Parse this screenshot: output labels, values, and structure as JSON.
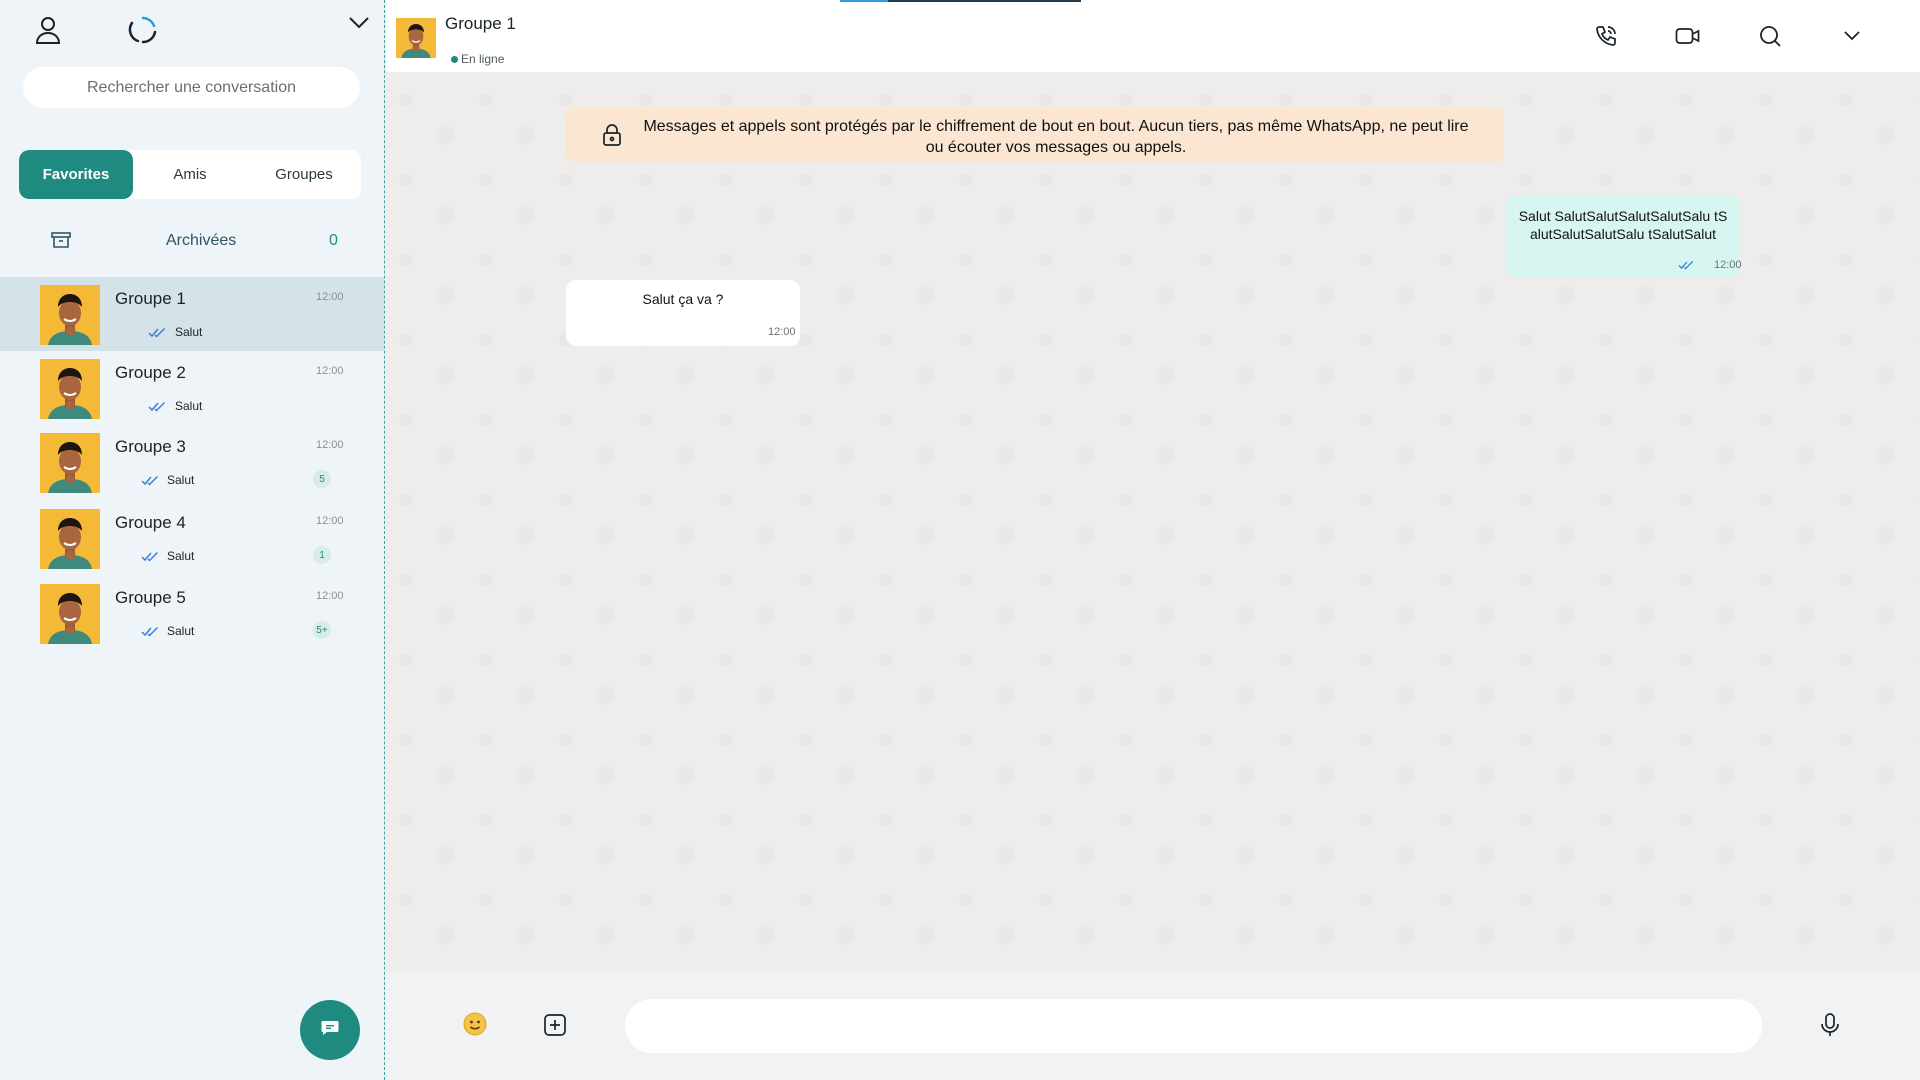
{
  "sidebar": {
    "search": {
      "placeholder": "Rechercher une conversation"
    },
    "tabs": [
      {
        "label": "Favorites",
        "active": true
      },
      {
        "label": "Amis",
        "active": false
      },
      {
        "label": "Groupes",
        "active": false
      }
    ],
    "archived": {
      "label": "Archivées",
      "count": "0"
    },
    "conversations": [
      {
        "name": "Groupe 1",
        "time": "12:00",
        "last_message": "Salut",
        "badge": "",
        "selected": true
      },
      {
        "name": "Groupe 2",
        "time": "12:00",
        "last_message": "Salut",
        "badge": ""
      },
      {
        "name": "Groupe 3",
        "time": "12:00",
        "last_message": "Salut",
        "badge": "5"
      },
      {
        "name": "Groupe 4",
        "time": "12:00",
        "last_message": "Salut",
        "badge": "1"
      },
      {
        "name": "Groupe 5",
        "time": "12:00",
        "last_message": "Salut",
        "badge": "5+"
      }
    ]
  },
  "chat": {
    "title": "Groupe 1",
    "status": "En ligne",
    "encryption_notice": "Messages et appels sont protégés par le chiffrement de bout en bout. Aucun tiers, pas même WhatsApp, ne peut lire ou écouter vos messages ou appels.",
    "messages": [
      {
        "direction": "out",
        "text": "Salut SalutSalutSalutSalutSalu tSalutSalutSalutSalu tSalutSalut",
        "time": "12:00"
      },
      {
        "direction": "in",
        "text": "Salut ça va ?",
        "time": "12:00"
      }
    ],
    "composer": {
      "placeholder": ""
    }
  },
  "icons": {
    "profile": "user-icon",
    "status": "status-ring-icon",
    "menu": "chevron-down-icon",
    "archive": "archive-icon",
    "call": "phone-icon",
    "video": "video-camera-icon",
    "search": "search-icon",
    "emoji": "emoji-icon",
    "attach": "plus-square-icon",
    "mic": "microphone-icon",
    "new_chat": "chat-bubble-icon"
  },
  "colors": {
    "accent": "#1f8b80",
    "sidebar_bg": "#eef4f8",
    "selected_row": "#d3e3e8",
    "outgoing_bubble": "#d8f6f1",
    "notice_bg": "#fbe6d2",
    "read_check": "#3b7fd6"
  }
}
